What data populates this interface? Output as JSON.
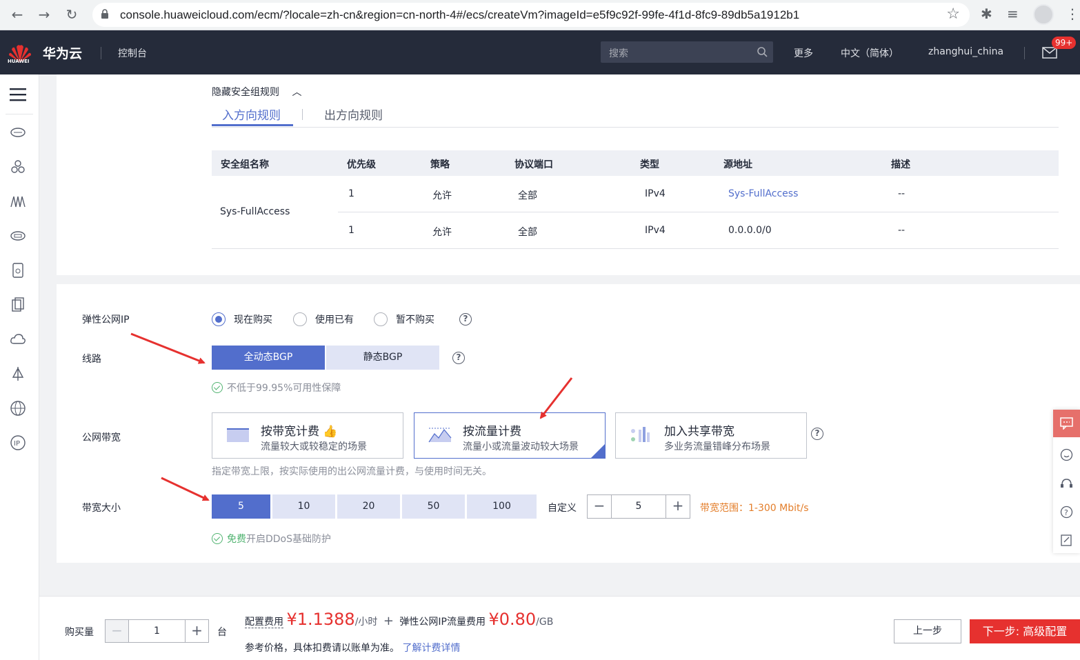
{
  "browser": {
    "url": "console.huaweicloud.com/ecm/?locale=zh-cn&region=cn-north-4#/ecs/createVm?imageId=e5f9c92f-99fe-4f1d-8fc9-89db5a1912b1"
  },
  "header": {
    "logo_text": "HUAWEI",
    "brand": "华为云",
    "console": "控制台",
    "search_placeholder": "搜索",
    "more": "更多",
    "language": "中文（简体）",
    "user": "zhanghui_china",
    "mail_badge": "99+"
  },
  "security_rules": {
    "hide_label": "隐藏安全组规则",
    "tabs": [
      "入方向规则",
      "出方向规则"
    ],
    "columns": [
      "安全组名称",
      "优先级",
      "策略",
      "协议端口",
      "类型",
      "源地址",
      "描述"
    ],
    "group_name": "Sys-FullAccess",
    "rows": [
      {
        "priority": "1",
        "policy": "允许",
        "port": "全部",
        "type": "IPv4",
        "source": "Sys-FullAccess",
        "desc": "--"
      },
      {
        "priority": "1",
        "policy": "允许",
        "port": "全部",
        "type": "IPv4",
        "source": "0.0.0.0/0",
        "desc": "--"
      }
    ]
  },
  "eip": {
    "label": "弹性公网IP",
    "options": [
      "现在购买",
      "使用已有",
      "暂不购买"
    ],
    "selected": "现在购买"
  },
  "line": {
    "label": "线路",
    "options": [
      "全动态BGP",
      "静态BGP"
    ],
    "selected": "全动态BGP",
    "note": "不低于99.95%可用性保障"
  },
  "bandwidth_billing": {
    "label": "公网带宽",
    "cards": [
      {
        "title": "按带宽计费",
        "desc": "流量较大或较稳定的场景"
      },
      {
        "title": "按流量计费",
        "desc": "流量小或流量波动较大场景"
      },
      {
        "title": "加入共享带宽",
        "desc": "多业务流量错峰分布场景"
      }
    ],
    "selected": "按流量计费",
    "hint": "指定带宽上限，按实际使用的出公网流量计费，与使用时间无关。"
  },
  "bandwidth_size": {
    "label": "带宽大小",
    "options": [
      "5",
      "10",
      "20",
      "50",
      "100"
    ],
    "selected": "5",
    "custom_label": "自定义",
    "custom_value": "5",
    "range": "带宽范围：1-300 Mbit/s",
    "ddos_free": "免费",
    "ddos_text": "开启DDoS基础防护"
  },
  "footer": {
    "qty_label": "购买量",
    "qty_value": "1",
    "qty_unit": "台",
    "config_fee_label": "配置费用",
    "config_fee": "¥1.1388",
    "config_fee_unit": "/小时",
    "plus": "+",
    "eip_fee_label": "弹性公网IP流量费用",
    "eip_fee": "¥0.80",
    "eip_fee_unit": "/GB",
    "ref_text": "参考价格，具体扣费请以账单为准。",
    "ref_link": "了解计费详情",
    "prev": "上一步",
    "next": "下一步: 高级配置"
  },
  "colors": {
    "primary": "#526ecc",
    "danger": "#e6312f",
    "header_bg": "#252b3a",
    "success": "#50b370",
    "warning": "#e37d29"
  }
}
